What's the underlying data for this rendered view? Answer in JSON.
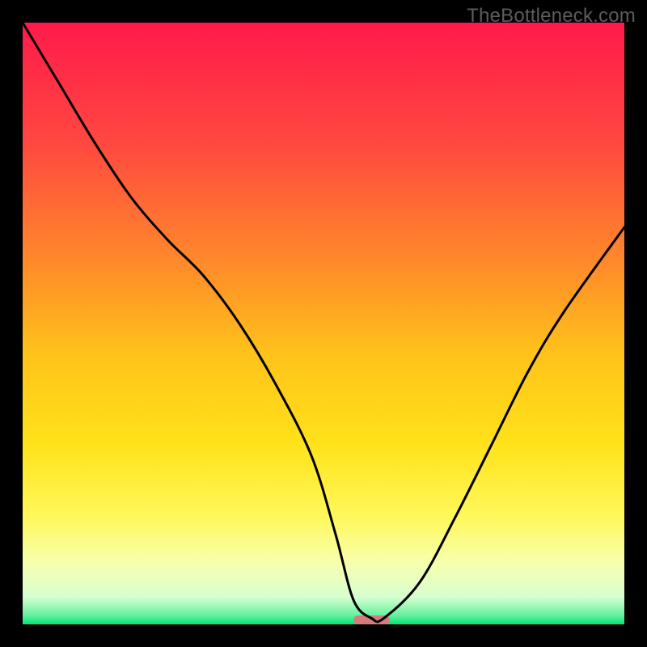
{
  "watermark": "TheBottleneck.com",
  "chart_data": {
    "type": "line",
    "title": "",
    "xlabel": "",
    "ylabel": "",
    "xlim": [
      0,
      100
    ],
    "ylim": [
      0,
      100
    ],
    "gradient_stops": [
      {
        "offset": 0,
        "color": "#ff1a4b"
      },
      {
        "offset": 0.2,
        "color": "#ff4840"
      },
      {
        "offset": 0.4,
        "color": "#ff8a2a"
      },
      {
        "offset": 0.55,
        "color": "#ffc21a"
      },
      {
        "offset": 0.7,
        "color": "#ffe21a"
      },
      {
        "offset": 0.82,
        "color": "#fff85a"
      },
      {
        "offset": 0.9,
        "color": "#f7ffb0"
      },
      {
        "offset": 0.955,
        "color": "#d6ffd0"
      },
      {
        "offset": 0.985,
        "color": "#66f0a0"
      },
      {
        "offset": 1.0,
        "color": "#00e676"
      }
    ],
    "series": [
      {
        "name": "bottleneck-curve",
        "x": [
          0,
          6,
          12,
          18,
          24,
          30,
          36,
          42,
          48,
          52,
          55,
          58,
          60,
          66,
          72,
          78,
          84,
          90,
          100
        ],
        "y": [
          100,
          90,
          80,
          71,
          64,
          58,
          50,
          40,
          28,
          15,
          4,
          1,
          1,
          7,
          18,
          30,
          42,
          52,
          66
        ]
      }
    ],
    "marker": {
      "name": "optimal-marker",
      "x": 58,
      "width": 6,
      "color": "#d87a78"
    }
  }
}
